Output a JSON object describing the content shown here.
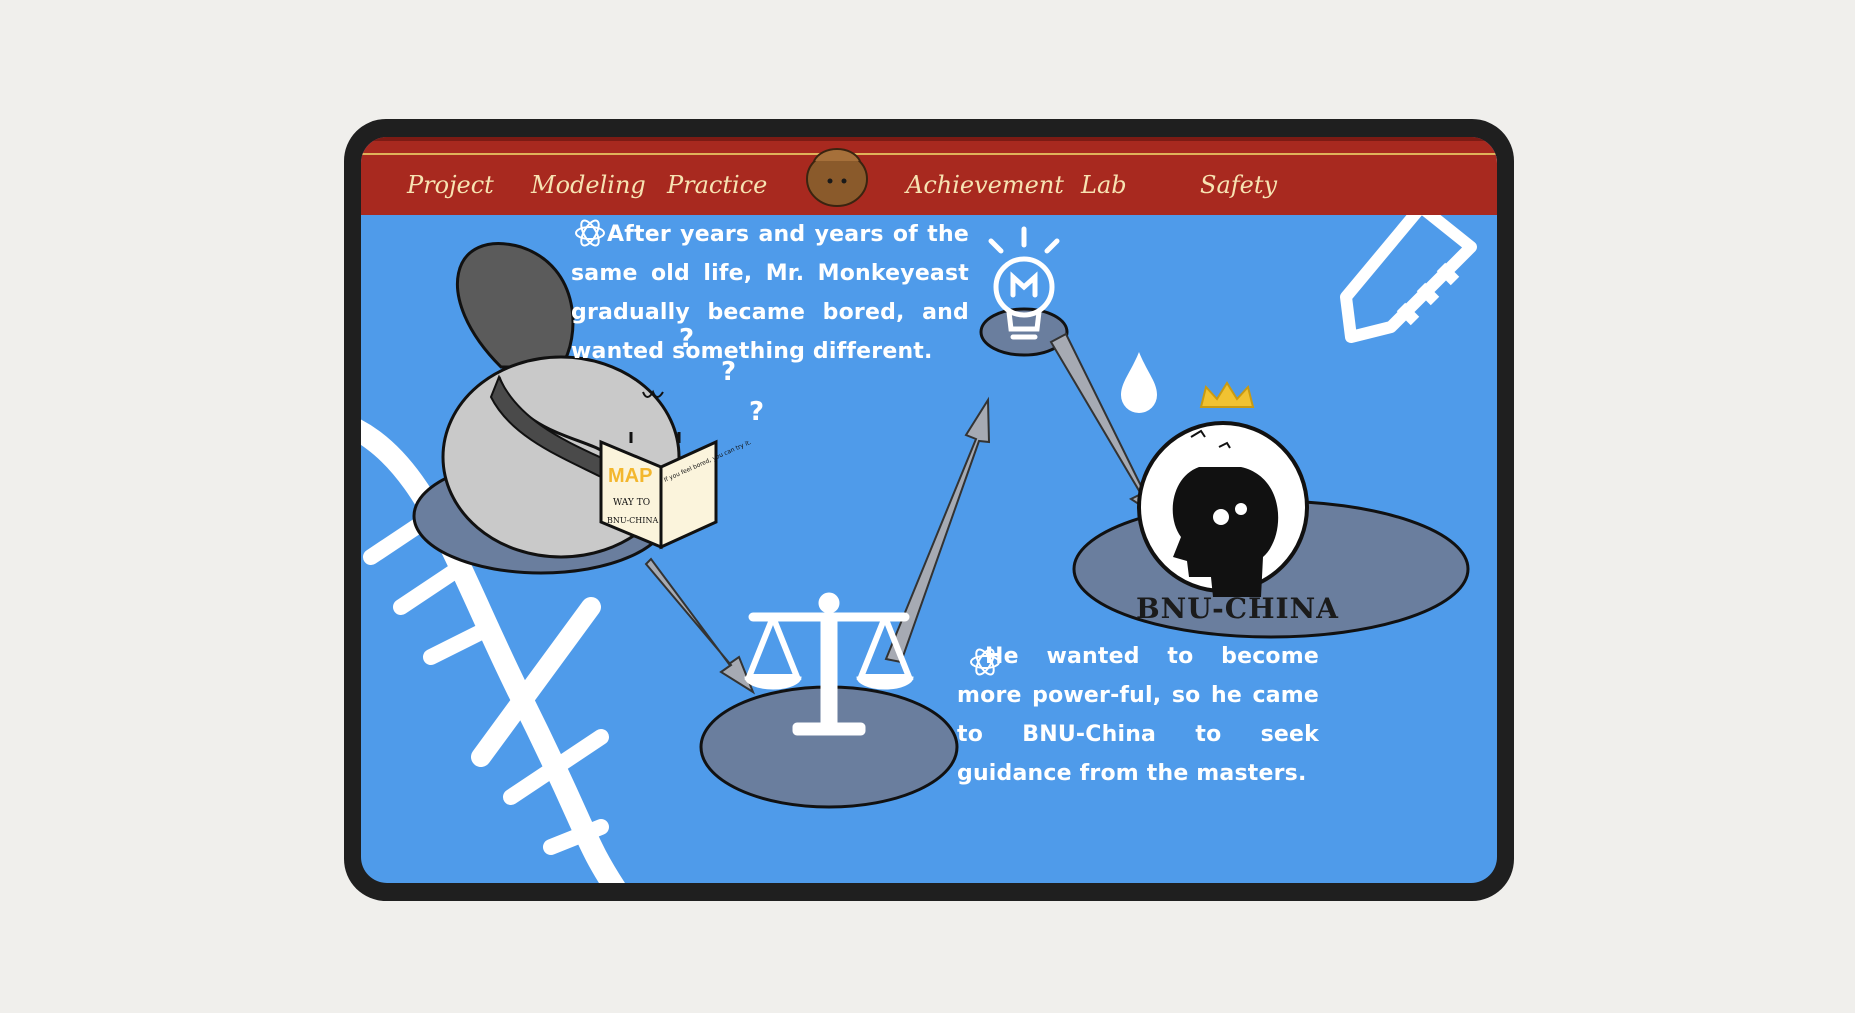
{
  "nav": {
    "items": [
      "Project",
      "Modeling",
      "Practice",
      "Achievement",
      "Lab",
      "Safety"
    ]
  },
  "story": {
    "caption1": "After years and years of the same old life, Mr. Monkeyeast gradually became bored, and wanted something different.",
    "caption2": "He wanted to become more power-ful, so he came to BNU-China to seek guidance from the masters."
  },
  "book": {
    "logo": "MAP",
    "cover_line1": "WAY TO",
    "cover_line2": "BNU-CHINA",
    "back_text": "If you feel bored, you can try it."
  },
  "brand": {
    "label": "BNU-CHINA"
  },
  "colors": {
    "page_bg": "#f0efec",
    "device_frame": "#1f1f1f",
    "screen_bg": "#4f9bea",
    "navbar_bg": "#a8291f",
    "nav_text": "#f7e3b2",
    "platform": "#6a7e9e"
  }
}
